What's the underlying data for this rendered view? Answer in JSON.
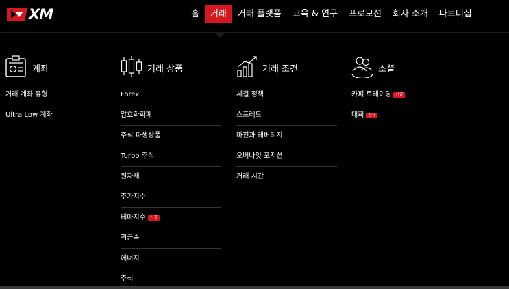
{
  "brand": {
    "name": "XM",
    "accent": "#d51820"
  },
  "nav": {
    "items": [
      {
        "label": "홈",
        "active": false
      },
      {
        "label": "거래",
        "active": true
      },
      {
        "label": "거래 플랫폼",
        "active": false
      },
      {
        "label": "교육 & 연구",
        "active": false
      },
      {
        "label": "프로모션",
        "active": false
      },
      {
        "label": "회사 소개",
        "active": false
      },
      {
        "label": "파트너십",
        "active": false
      }
    ]
  },
  "menu": {
    "accounts": {
      "title": "계좌",
      "icon": "id-card-icon",
      "items": [
        {
          "label": "거래 계좌 유형",
          "badge": ""
        },
        {
          "label": "Ultra Low 계좌",
          "badge": ""
        }
      ]
    },
    "products": {
      "title": "거래 상품",
      "icon": "candlestick-icon",
      "items": [
        {
          "label": "Forex",
          "badge": ""
        },
        {
          "label": "암호화화폐",
          "badge": ""
        },
        {
          "label": "주식 파생상품",
          "badge": ""
        },
        {
          "label": "Turbo 주식",
          "badge": ""
        },
        {
          "label": "원자재",
          "badge": ""
        },
        {
          "label": "주가지수",
          "badge": ""
        },
        {
          "label": "테마지수",
          "badge": "신규"
        },
        {
          "label": "귀금속",
          "badge": ""
        },
        {
          "label": "에너지",
          "badge": ""
        },
        {
          "label": "주식",
          "badge": ""
        }
      ]
    },
    "conditions": {
      "title": "거래 조건",
      "icon": "growth-chart-icon",
      "items": [
        {
          "label": "체결 정책",
          "badge": ""
        },
        {
          "label": "스프레드",
          "badge": ""
        },
        {
          "label": "마진과 레버리지",
          "badge": ""
        },
        {
          "label": "오버나잇 포지션",
          "badge": ""
        },
        {
          "label": "거래 시간",
          "badge": ""
        }
      ]
    },
    "social": {
      "title": "소셜",
      "icon": "users-icon",
      "items": [
        {
          "label": "카피 트레이딩",
          "badge": "신규"
        },
        {
          "label": "대회",
          "badge": "신규"
        }
      ]
    }
  }
}
